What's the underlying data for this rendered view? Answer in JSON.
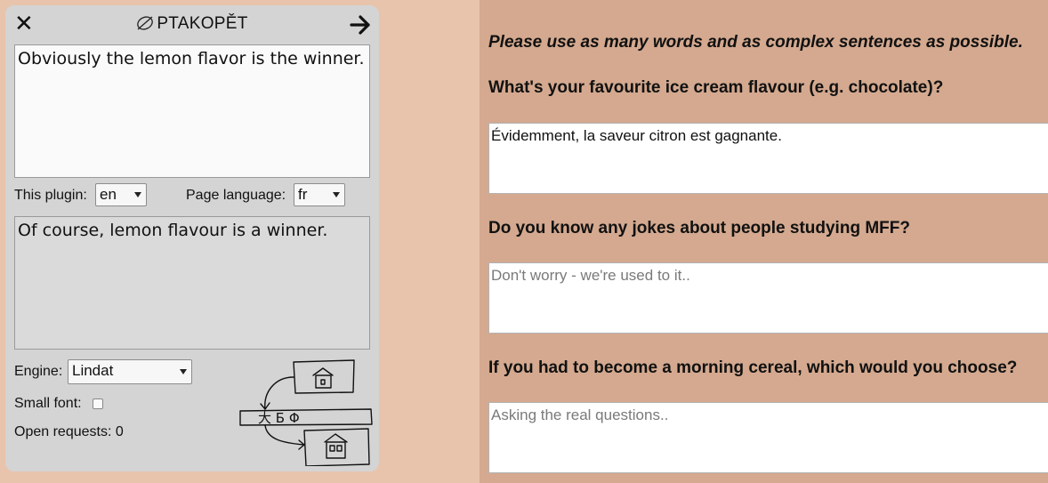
{
  "plugin": {
    "title": "PTAKOPĚT",
    "close_icon": "close-icon",
    "forward_icon": "arrow-right-icon",
    "source_text": "Obviously the lemon flavor is the winner.",
    "plugin_lang_label": "This plugin:",
    "plugin_lang_value": "en",
    "page_lang_label": "Page language:",
    "page_lang_value": "fr",
    "backtranslation_text": "Of course, lemon flavour is a winner.",
    "engine_label": "Engine:",
    "engine_value": "Lindat",
    "small_font_label": "Small font:",
    "small_font_checked": false,
    "open_requests": "Open requests: 0",
    "diagram_glyphs": "大  Б  Φ"
  },
  "page": {
    "intro": "Please use as many words and as complex sentences as possible.",
    "questions": [
      {
        "label": "What's your favourite ice cream flavour (e.g. chocolate)?",
        "value": "Évidemment, la saveur citron est gagnante.",
        "placeholder": ""
      },
      {
        "label": "Do you know any jokes about people studying MFF?",
        "value": "",
        "placeholder": "Don't worry - we're used to it.."
      },
      {
        "label": "If you had to become a morning cereal, which would you choose?",
        "value": "",
        "placeholder": "Asking the real questions.."
      }
    ]
  }
}
